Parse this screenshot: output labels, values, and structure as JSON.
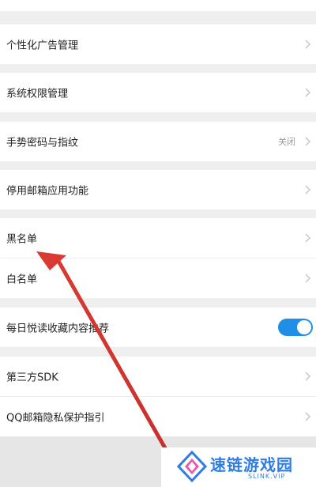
{
  "settings": {
    "rows": [
      {
        "label": "个性化广告管理"
      },
      {
        "label": "系统权限管理"
      },
      {
        "label": "手势密码与指纹",
        "value": "关闭"
      },
      {
        "label": "停用邮箱应用功能"
      },
      {
        "label": "黑名单"
      },
      {
        "label": "白名单"
      },
      {
        "label": "每日悦读收藏内容推荐",
        "toggle_on": true
      },
      {
        "label": "第三方SDK"
      },
      {
        "label": "QQ邮箱隐私保护指引"
      }
    ]
  },
  "annotation": {
    "arrow_color": "#d93a34",
    "target": "黑名单"
  },
  "watermark": {
    "title": "速链游戏园",
    "subtitle": "SLINK.VIP",
    "color": "#2f7de1"
  },
  "colors": {
    "toggle_on": "#1f8ee6",
    "background": "#efefef"
  }
}
